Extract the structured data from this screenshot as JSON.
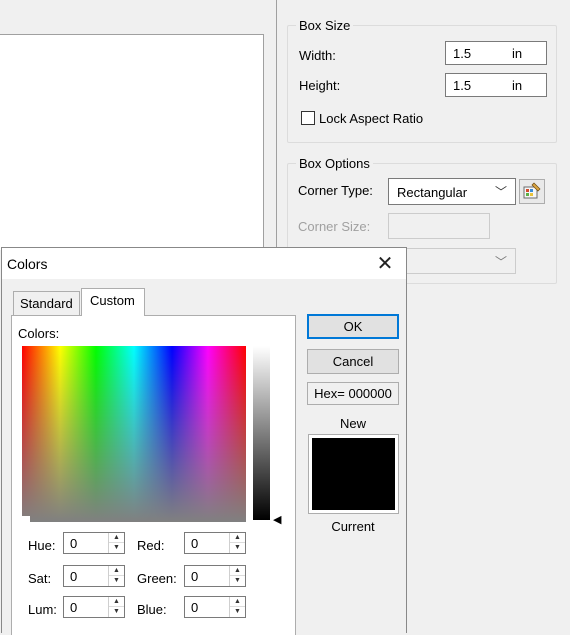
{
  "box_size": {
    "title": "Box Size",
    "width_label": "Width:",
    "width_value": "1.5",
    "width_unit": "in",
    "height_label": "Height:",
    "height_value": "1.5",
    "height_unit": "in",
    "lock_aspect_label": "Lock Aspect Ratio",
    "lock_aspect_checked": false
  },
  "box_options": {
    "title": "Box Options",
    "corner_type_label": "Corner Type:",
    "corner_type_value": "Rectangular",
    "corner_size_label": "Corner Size:",
    "corner_size_value": "",
    "extra_dropdown_value": ""
  },
  "colors_dialog": {
    "title": "Colors",
    "close_glyph": "✕",
    "tabs": [
      "Standard",
      "Custom"
    ],
    "active_tab": "Custom",
    "colors_label": "Colors:",
    "fields": {
      "hue_label": "Hue:",
      "hue": "0",
      "sat_label": "Sat:",
      "sat": "0",
      "lum_label": "Lum:",
      "lum": "0",
      "red_label": "Red:",
      "red": "0",
      "green_label": "Green:",
      "green": "0",
      "blue_label": "Blue:",
      "blue": "0"
    },
    "ok_label": "OK",
    "cancel_label": "Cancel",
    "hex_label": "Hex= 000000",
    "new_label": "New",
    "current_label": "Current",
    "preview_color": "#000000"
  },
  "icons": {
    "dropdown_arrow": "﹀",
    "spin_up": "▲",
    "spin_down": "▼",
    "lum_pointer": "◀",
    "palette_icon": "palette-edit"
  }
}
